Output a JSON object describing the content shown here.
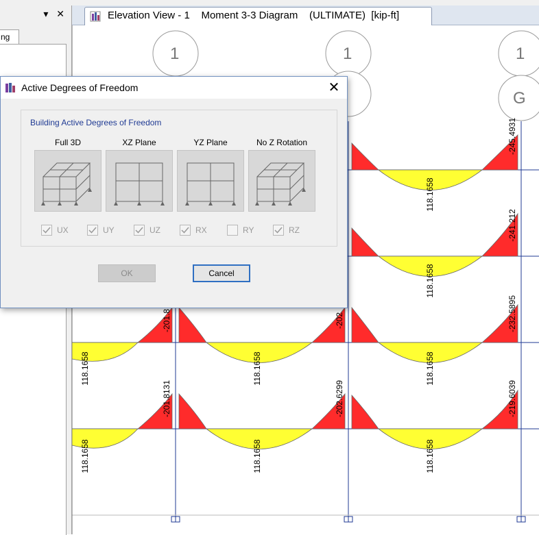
{
  "panel": {
    "controls": "▾ ✕",
    "tab_label": "ng"
  },
  "view": {
    "tab_title": "Elevation View - 1    Moment 3-3 Diagram    (ULTIMATE)  [kip-ft]"
  },
  "grid_bubbles": [
    "1",
    "1",
    "1",
    "G"
  ],
  "moments": {
    "row1": [
      "-245.4931",
      "118.1658"
    ],
    "row2": [
      "-241.212",
      "118.1658"
    ],
    "row3": [
      "-201.8",
      "-202",
      "-232.5895",
      "118.1658",
      "118.1658",
      "118.1658"
    ],
    "row4": [
      "-201.8131",
      "-202.6299",
      "-219.6039",
      "118.1658",
      "118.1658",
      "118.1658"
    ]
  },
  "dialog": {
    "title": "Active Degrees of Freedom",
    "close": "✕",
    "group_title": "Building Active Degrees of Freedom",
    "options": [
      {
        "label": "Full 3D"
      },
      {
        "label": "XZ Plane"
      },
      {
        "label": "YZ Plane"
      },
      {
        "label": "No Z Rotation"
      }
    ],
    "checkboxes": [
      {
        "label": "UX",
        "checked": true
      },
      {
        "label": "UY",
        "checked": true
      },
      {
        "label": "UZ",
        "checked": true
      },
      {
        "label": "RX",
        "checked": true
      },
      {
        "label": "RY",
        "checked": false
      },
      {
        "label": "RZ",
        "checked": true
      }
    ],
    "ok_label": "OK",
    "cancel_label": "Cancel"
  },
  "colors": {
    "positive_moment": "#ffff33",
    "negative_moment": "#ff2b2b",
    "frame_line": "#1f3a93",
    "accent": "#2f6fc2"
  }
}
